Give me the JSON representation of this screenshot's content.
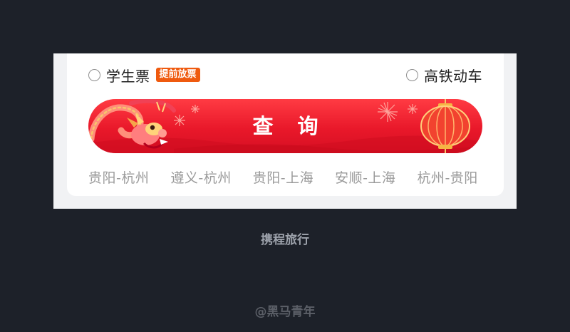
{
  "options": {
    "student": {
      "label": "学生票",
      "tag": "提前放票"
    },
    "highspeed": {
      "label": "高铁动车"
    }
  },
  "search": {
    "label": "查 询"
  },
  "routes": [
    "贵阳-杭州",
    "遵义-杭州",
    "贵阳-上海",
    "安顺-上海",
    "杭州-贵阳"
  ],
  "captions": {
    "app": "携程旅行",
    "watermark": "@黑马青年"
  },
  "colors": {
    "page_bg": "#1d2129",
    "button_red": "#e9182a",
    "tag_orange": "#ef5a0f"
  }
}
